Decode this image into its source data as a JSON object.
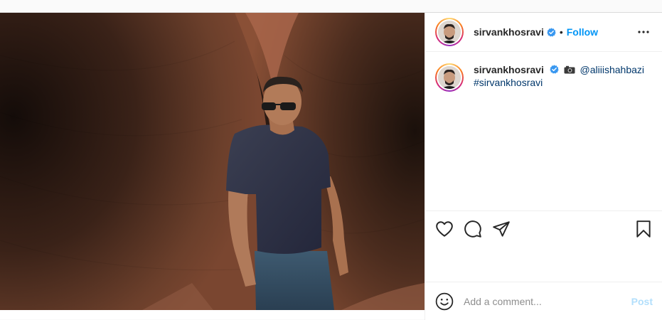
{
  "post": {
    "username": "sirvankhosravi",
    "separator": "•",
    "follow_label": "Follow",
    "caption_mention": "@aliiishahbazi",
    "caption_hashtag": "#sirvankhosravi",
    "image_alt": "Man in navy t-shirt and sunglasses standing in front of rusty curved steel sculpture"
  },
  "comment_box": {
    "placeholder": "Add a comment...",
    "post_label": "Post"
  },
  "icons": {
    "verified": "verified-badge-icon",
    "more": "more-options-icon",
    "like": "heart-icon",
    "comment": "comment-icon",
    "share": "share-icon",
    "save": "bookmark-icon",
    "emoji": "emoji-icon",
    "camera": "camera-emoji-icon"
  },
  "colors": {
    "accent": "#0095f6",
    "post_disabled": "#b2dffc",
    "text": "#262626",
    "muted": "#8e8e8e"
  }
}
